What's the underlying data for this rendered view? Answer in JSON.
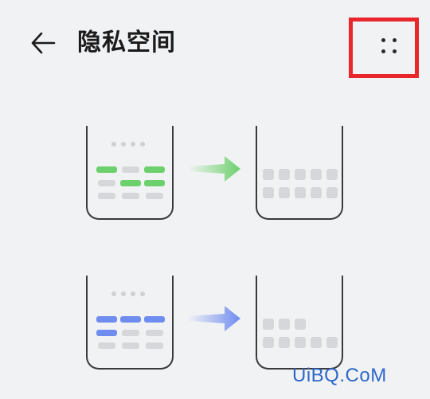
{
  "header": {
    "title": "隐私空间",
    "back_icon": "arrow-left-icon",
    "more_icon": "more-dots-icon",
    "highlight_color": "#e8262b"
  },
  "illustrations": [
    {
      "name": "green-transfer",
      "accent_color": "#6cd16c",
      "arrow_icon": "arrow-right-green-icon"
    },
    {
      "name": "blue-transfer",
      "accent_color": "#6f8cf0",
      "arrow_icon": "arrow-right-blue-icon"
    }
  ],
  "watermark": {
    "text": "UiBQ.CoM",
    "color": "#2e68c8"
  }
}
